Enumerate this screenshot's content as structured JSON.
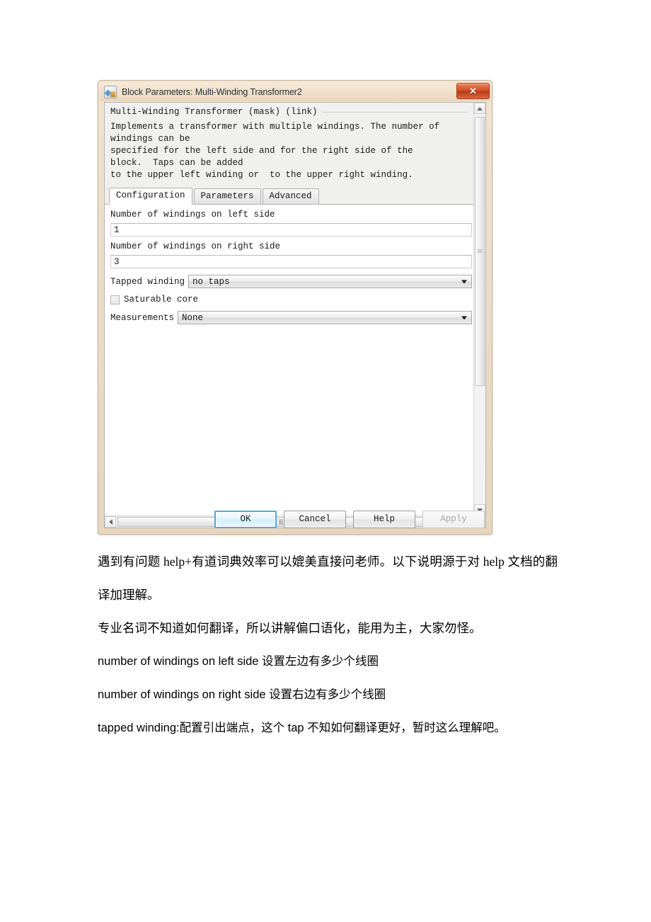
{
  "dialog": {
    "title": "Block Parameters: Multi-Winding Transformer2",
    "close_label": "✕",
    "group_title": "Multi-Winding Transformer (mask) (link)",
    "description": "Implements a transformer with multiple windings. The number of\nwindings can be\nspecified for the left side and for the right side of the\nblock.  Taps can be added\nto the upper left winding or  to the upper right winding.",
    "tabs": [
      {
        "label": "Configuration",
        "active": true
      },
      {
        "label": "Parameters",
        "active": false
      },
      {
        "label": "Advanced",
        "active": false
      }
    ],
    "fields": {
      "left_windings_label": "Number of windings on left side",
      "left_windings_value": "1",
      "right_windings_label": "Number of windings on right side",
      "right_windings_value": "3",
      "tapped_winding_label": "Tapped winding",
      "tapped_winding_value": "no taps",
      "saturable_core_label": "Saturable core",
      "saturable_core_checked": false,
      "measurements_label": "Measurements",
      "measurements_value": "None"
    },
    "buttons": {
      "ok": "OK",
      "cancel": "Cancel",
      "help": "Help",
      "apply": "Apply"
    }
  },
  "document": {
    "paragraphs": [
      "遇到有问题 help+有道词典效率可以媲美直接问老师。以下说明源于对 help 文档的翻译加理解。",
      "专业名词不知道如何翻译，所以讲解偏口语化，能用为主，大家勿怪。",
      "number of windings on left side 设置左边有多少个线圈",
      "number of windings on right side  设置右边有多少个线圈",
      "tapped winding:配置引出端点，这个 tap 不知如何翻译更好，暂时这么理解吧。"
    ]
  },
  "colors": {
    "title_bar": "#f0dfc8",
    "close_button": "#d4512a",
    "focus_ring": "#4fa8dd",
    "window_frame": "#e8d5bd"
  }
}
